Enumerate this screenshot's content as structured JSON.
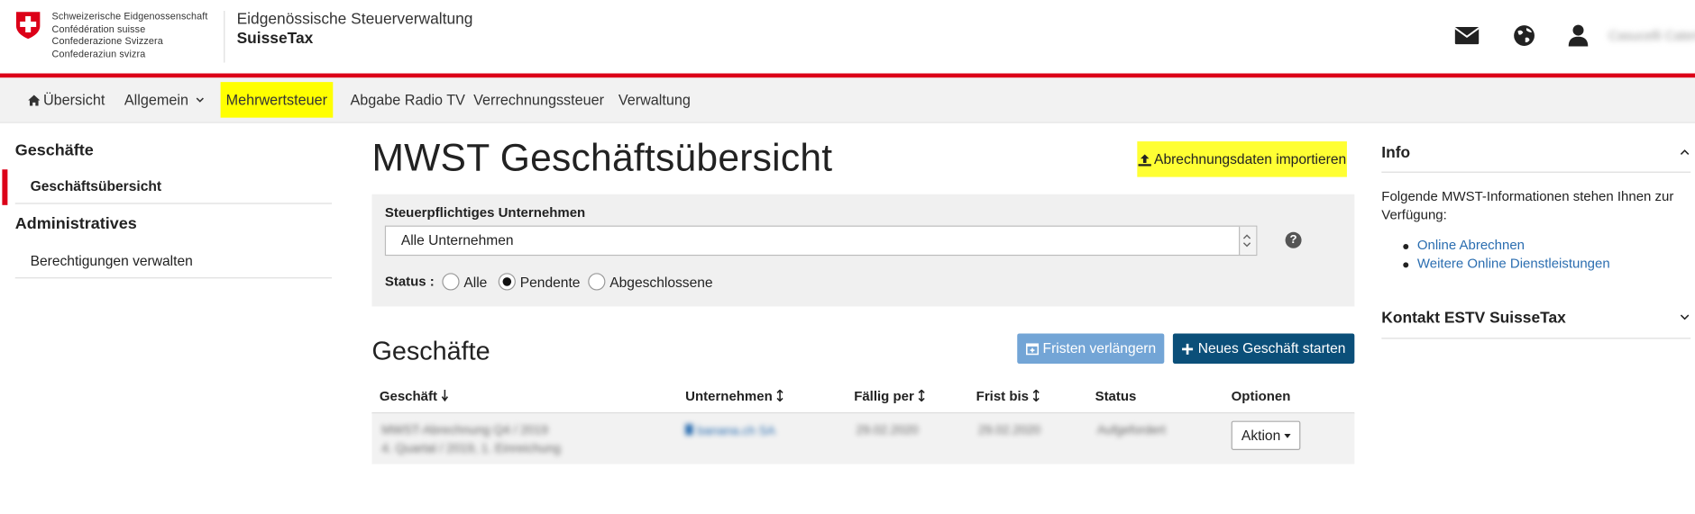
{
  "header": {
    "crest_text": [
      "Schweizerische Eidgenossenschaft",
      "Confédération suisse",
      "Confederazione Svizzera",
      "Confederaziun svizra"
    ],
    "organization": "Eidgenössische Steuerverwaltung",
    "app_name": "SuisseTax",
    "user_name": "Casucelli Caterina",
    "icons": [
      "envelope-icon",
      "globe-icon",
      "user-icon"
    ],
    "brand_red": "#dc0018"
  },
  "nav": {
    "items": [
      {
        "label": "Übersicht",
        "icon": "home-icon"
      },
      {
        "label": "Allgemein",
        "icon": "chevron-down-icon"
      },
      {
        "label": "Mehrwertsteuer",
        "active": true
      },
      {
        "label": "Abgabe Radio TV"
      },
      {
        "label": "Verrechnungssteuer"
      },
      {
        "label": "Verwaltung"
      }
    ],
    "highlight_color": "#ffff00"
  },
  "sidebar": {
    "section1": "Geschäfte",
    "item1": "Geschäftsübersicht",
    "section2": "Administratives",
    "item2": "Berechtigungen verwalten"
  },
  "main": {
    "title": "MWST Geschäftsübersicht",
    "import_button": "Abrechnungsdaten importieren",
    "filter": {
      "company_label": "Steuerpflichtiges Unternehmen",
      "company_value": "Alle Unternehmen",
      "status_label": "Status :",
      "options": [
        "Alle",
        "Pendente",
        "Abgeschlossene"
      ],
      "selected": "Pendente"
    },
    "section_title": "Geschäfte",
    "extend_button": "Fristen verlängern",
    "new_button": "Neues Geschäft starten",
    "table": {
      "headers": [
        "Geschäft",
        "Unternehmen",
        "Fällig per",
        "Frist bis",
        "Status",
        "Optionen"
      ],
      "rows": [
        {
          "geschaeft_line1": "MWST-Abrechnung Q4 / 2019",
          "geschaeft_line2": "4. Quartal / 2019, 1. Einreichung",
          "unternehmen": "banana.ch SA",
          "faellig": "29.02.2020",
          "frist": "29.02.2020",
          "status": "Aufgefordert",
          "option": "Aktion"
        }
      ]
    }
  },
  "info": {
    "title": "Info",
    "text": "Folgende MWST-Informationen stehen Ihnen zur Verfügung:",
    "links": [
      "Online Abrechnen",
      "Weitere Online Dienstleistungen"
    ],
    "kontakt": "Kontakt ESTV SuisseTax"
  }
}
